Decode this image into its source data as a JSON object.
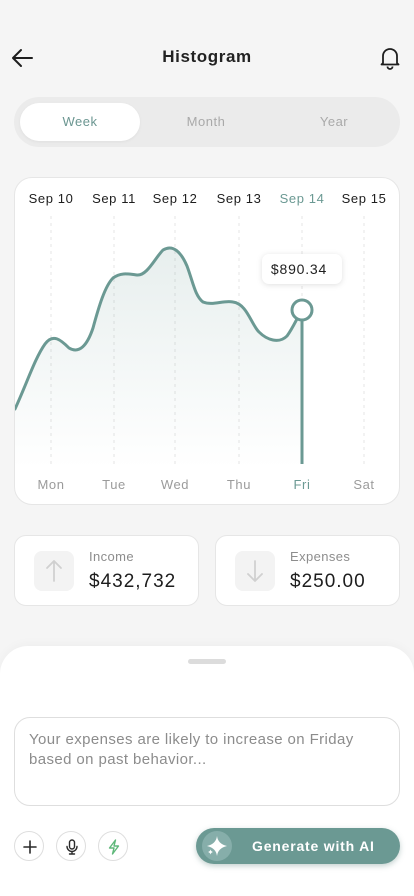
{
  "header": {
    "title": "Histogram",
    "back_icon": "arrow-left-icon",
    "notification_icon": "bell-icon"
  },
  "tabs": [
    {
      "label": "Week",
      "active": true
    },
    {
      "label": "Month",
      "active": false
    },
    {
      "label": "Year",
      "active": false
    }
  ],
  "chart_data": {
    "type": "area",
    "dates": [
      "Sep 10",
      "Sep 11",
      "Sep 12",
      "Sep 13",
      "Sep 14",
      "Sep 15"
    ],
    "categories": [
      "Mon",
      "Tue",
      "Wed",
      "Thu",
      "Fri",
      "Sat"
    ],
    "selected_index": 4,
    "tooltip": "$890.34",
    "line_color": "#6b9993",
    "active_label_color": "#6b9993",
    "muted_label_color": "#9b9b9b",
    "grid": true
  },
  "stats": {
    "income": {
      "label": "Income",
      "value": "$432,732",
      "icon": "arrow-up-icon"
    },
    "expenses": {
      "label": "Expenses",
      "value": "$250.00",
      "icon": "arrow-down-icon"
    }
  },
  "assistant": {
    "prompt_value": "Your expenses are likely to increase on Friday based on past behavior...",
    "add_icon": "plus-icon",
    "mic_icon": "microphone-icon",
    "quick_icon": "lightning-icon",
    "generate_label": "Generate with AI",
    "generate_icon": "sparkle-icon"
  }
}
